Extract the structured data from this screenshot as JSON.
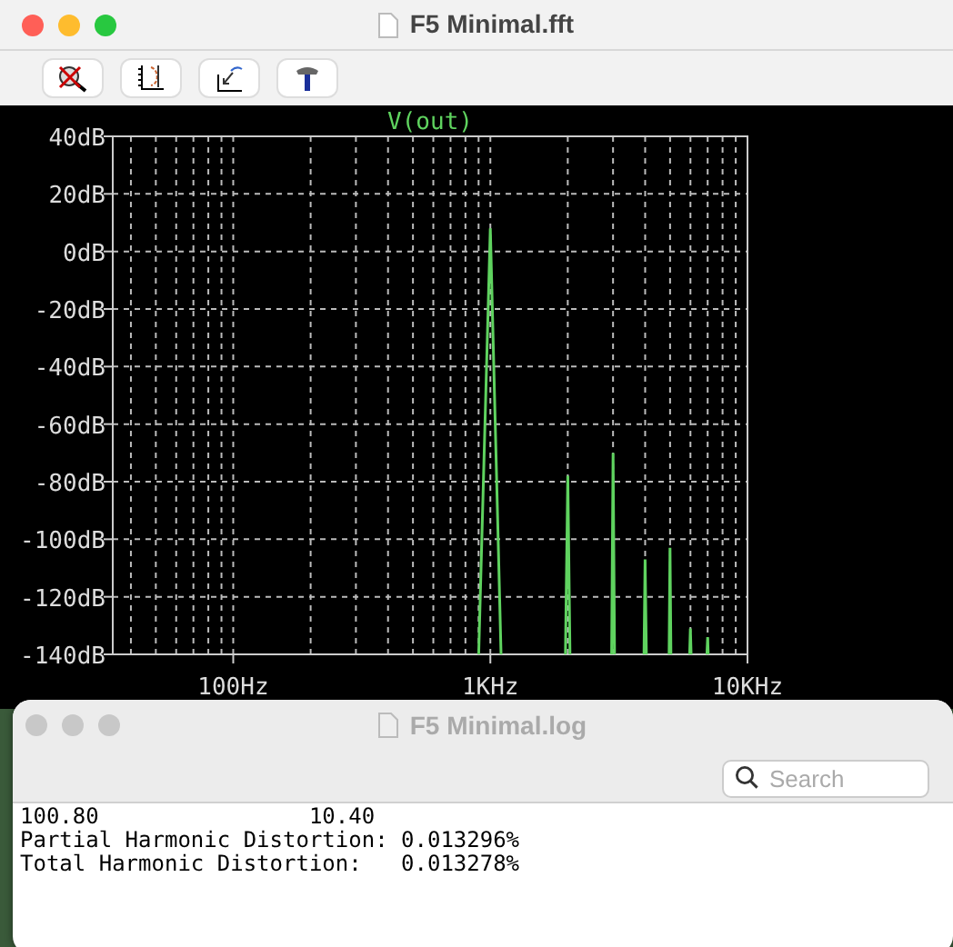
{
  "fft_window": {
    "title": "F5 Minimal.fft",
    "plot": {
      "trace_name": "V(out)",
      "y_labels": [
        "40dB",
        "20dB",
        "0dB",
        "-20dB",
        "-40dB",
        "-60dB",
        "-80dB",
        "-100dB",
        "-120dB",
        "-140dB"
      ],
      "x_labels": [
        "100Hz",
        "1KHz",
        "10KHz"
      ]
    }
  },
  "log_window": {
    "title": "F5 Minimal.log",
    "search": {
      "placeholder": "Search"
    },
    "lines": [
      "100.80                10.40",
      "Partial Harmonic Distortion: 0.013296%",
      "Total Harmonic Distortion:   0.013278%"
    ]
  }
}
